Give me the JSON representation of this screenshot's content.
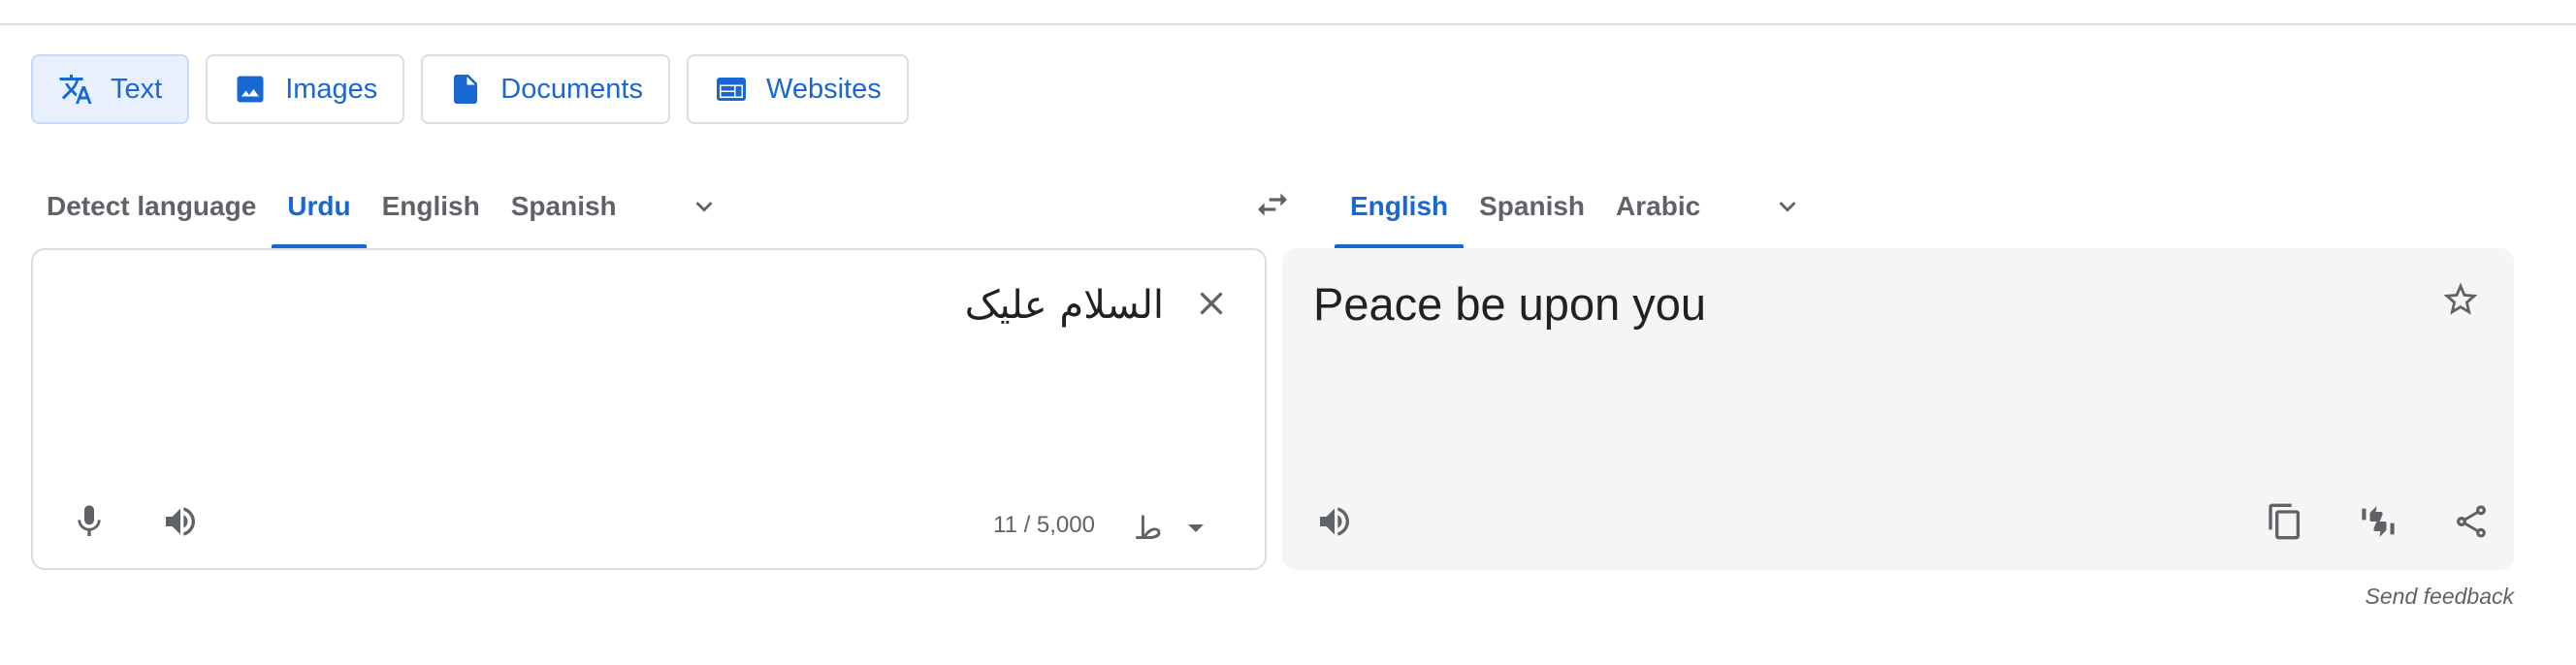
{
  "modes": [
    {
      "label": "Text",
      "icon": "translate-icon",
      "active": true
    },
    {
      "label": "Images",
      "icon": "image-icon",
      "active": false
    },
    {
      "label": "Documents",
      "icon": "document-icon",
      "active": false
    },
    {
      "label": "Websites",
      "icon": "website-icon",
      "active": false
    }
  ],
  "source_langs": [
    {
      "label": "Detect language",
      "active": false
    },
    {
      "label": "Urdu",
      "active": true
    },
    {
      "label": "English",
      "active": false
    },
    {
      "label": "Spanish",
      "active": false
    }
  ],
  "target_langs": [
    {
      "label": "English",
      "active": true
    },
    {
      "label": "Spanish",
      "active": false
    },
    {
      "label": "Arabic",
      "active": false
    }
  ],
  "source": {
    "text": "السلام علیک",
    "char_count": "11 / 5,000",
    "keyboard_glyph": "ط"
  },
  "target": {
    "text": "Peace be upon you"
  },
  "feedback": "Send feedback",
  "colors": {
    "accent": "#1967d2",
    "active_bg": "#e8f0fe",
    "icon_gray": "#5f6368",
    "target_bg": "#f5f5f5"
  }
}
